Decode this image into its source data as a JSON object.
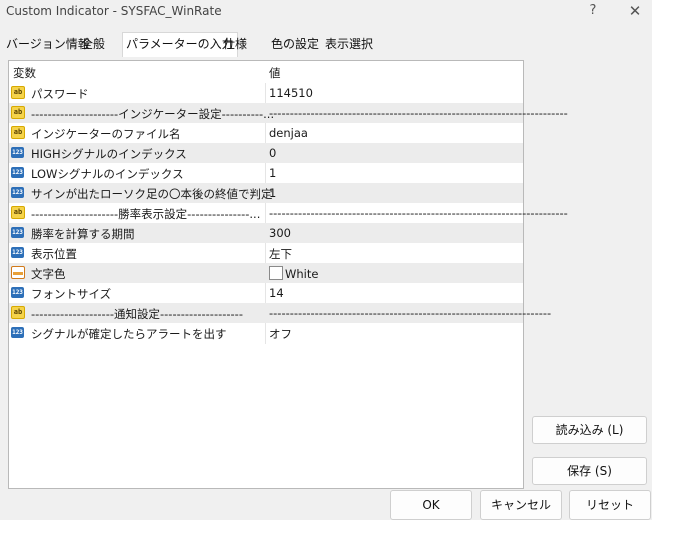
{
  "window": {
    "title": "Custom Indicator - SYSFAC_WinRate",
    "help": "?",
    "close": "✕"
  },
  "tabs": [
    "バージョン情報",
    "全般",
    "パラメーターの入力",
    "仕様",
    "色の設定",
    "表示選択"
  ],
  "grid": {
    "headers": [
      "変数",
      "値"
    ],
    "rows": [
      {
        "icon": "ab",
        "label": "パスワード",
        "value": "114510"
      },
      {
        "icon": "ab",
        "label": "---------------------インジケーター設定----------...",
        "value": "------------------------------------------------------------------------"
      },
      {
        "icon": "ab",
        "label": "インジケーターのファイル名",
        "value": "denjaa"
      },
      {
        "icon": "123",
        "label": "HIGHシグナルのインデックス",
        "value": "0"
      },
      {
        "icon": "123",
        "label": "LOWシグナルのインデックス",
        "value": "1"
      },
      {
        "icon": "123",
        "label": "サインが出たローソク足の〇本後の終値で判定",
        "value": "1"
      },
      {
        "icon": "ab",
        "label": "---------------------勝率表示設定---------------...",
        "value": "------------------------------------------------------------------------"
      },
      {
        "icon": "123",
        "label": "勝率を計算する期間",
        "value": "300"
      },
      {
        "icon": "123",
        "label": "表示位置",
        "value": "左下"
      },
      {
        "icon": "color",
        "label": "文字色",
        "value": "White"
      },
      {
        "icon": "123",
        "label": "フォントサイズ",
        "value": "14"
      },
      {
        "icon": "ab",
        "label": "--------------------通知設定--------------------",
        "value": "--------------------------------------------------------------------"
      },
      {
        "icon": "123",
        "label": "シグナルが確定したらアラートを出す",
        "value": "オフ"
      }
    ]
  },
  "buttons": {
    "load": "読み込み (L)",
    "save": "保存 (S)",
    "ok": "OK",
    "cancel": "キャンセル",
    "reset": "リセット"
  }
}
